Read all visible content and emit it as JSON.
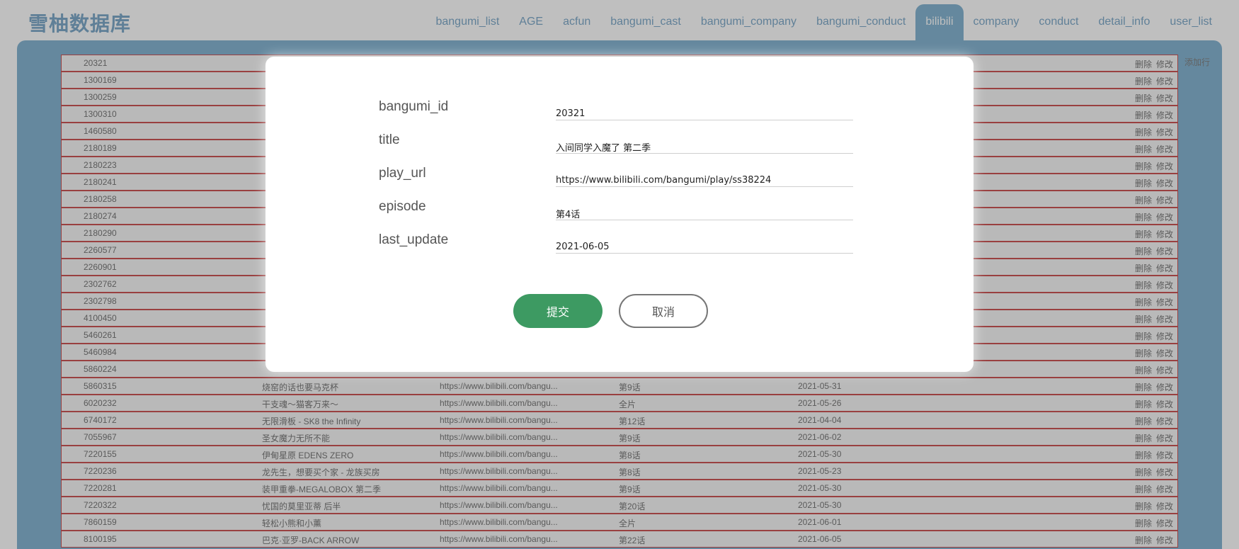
{
  "app": {
    "logo": "雪柚数据库"
  },
  "nav": {
    "tabs": [
      {
        "label": "bangumi_list",
        "active": false
      },
      {
        "label": "AGE",
        "active": false
      },
      {
        "label": "acfun",
        "active": false
      },
      {
        "label": "bangumi_cast",
        "active": false
      },
      {
        "label": "bangumi_company",
        "active": false
      },
      {
        "label": "bangumi_conduct",
        "active": false
      },
      {
        "label": "bilibili",
        "active": true
      },
      {
        "label": "company",
        "active": false
      },
      {
        "label": "conduct",
        "active": false
      },
      {
        "label": "detail_info",
        "active": false
      },
      {
        "label": "user_list",
        "active": false
      }
    ]
  },
  "table": {
    "add_row_label": "添加行",
    "delete_label": "删除",
    "edit_label": "修改",
    "rows": [
      {
        "id": "20321",
        "title": "",
        "url": "",
        "episode": "",
        "date": ""
      },
      {
        "id": "1300169",
        "title": "",
        "url": "",
        "episode": "",
        "date": ""
      },
      {
        "id": "1300259",
        "title": "",
        "url": "",
        "episode": "",
        "date": ""
      },
      {
        "id": "1300310",
        "title": "",
        "url": "",
        "episode": "",
        "date": ""
      },
      {
        "id": "1460580",
        "title": "",
        "url": "",
        "episode": "",
        "date": ""
      },
      {
        "id": "2180189",
        "title": "",
        "url": "",
        "episode": "",
        "date": ""
      },
      {
        "id": "2180223",
        "title": "",
        "url": "",
        "episode": "",
        "date": ""
      },
      {
        "id": "2180241",
        "title": "",
        "url": "",
        "episode": "",
        "date": ""
      },
      {
        "id": "2180258",
        "title": "",
        "url": "",
        "episode": "",
        "date": ""
      },
      {
        "id": "2180274",
        "title": "",
        "url": "",
        "episode": "",
        "date": ""
      },
      {
        "id": "2180290",
        "title": "",
        "url": "",
        "episode": "",
        "date": ""
      },
      {
        "id": "2260577",
        "title": "",
        "url": "",
        "episode": "",
        "date": ""
      },
      {
        "id": "2260901",
        "title": "",
        "url": "",
        "episode": "",
        "date": ""
      },
      {
        "id": "2302762",
        "title": "",
        "url": "",
        "episode": "",
        "date": ""
      },
      {
        "id": "2302798",
        "title": "",
        "url": "",
        "episode": "",
        "date": ""
      },
      {
        "id": "4100450",
        "title": "",
        "url": "",
        "episode": "",
        "date": ""
      },
      {
        "id": "5460261",
        "title": "",
        "url": "",
        "episode": "",
        "date": ""
      },
      {
        "id": "5460984",
        "title": "",
        "url": "",
        "episode": "",
        "date": ""
      },
      {
        "id": "5860224",
        "title": "",
        "url": "",
        "episode": "",
        "date": ""
      },
      {
        "id": "5860315",
        "title": "烧窑的话也要马克杯",
        "url": "https://www.bilibili.com/bangu...",
        "episode": "第9话",
        "date": "2021-05-31"
      },
      {
        "id": "6020232",
        "title": "干支魂～猫客万来～",
        "url": "https://www.bilibili.com/bangu...",
        "episode": "全片",
        "date": "2021-05-26"
      },
      {
        "id": "6740172",
        "title": "无限滑板 - SK8 the Infinity",
        "url": "https://www.bilibili.com/bangu...",
        "episode": "第12话",
        "date": "2021-04-04"
      },
      {
        "id": "7055967",
        "title": "圣女魔力无所不能",
        "url": "https://www.bilibili.com/bangu...",
        "episode": "第9话",
        "date": "2021-06-02"
      },
      {
        "id": "7220155",
        "title": "伊甸星原 EDENS ZERO",
        "url": "https://www.bilibili.com/bangu...",
        "episode": "第8话",
        "date": "2021-05-30"
      },
      {
        "id": "7220236",
        "title": "龙先生，想要买个家 - 龙族买房",
        "url": "https://www.bilibili.com/bangu...",
        "episode": "第8话",
        "date": "2021-05-23"
      },
      {
        "id": "7220281",
        "title": "装甲重拳-MEGALOBOX 第二季",
        "url": "https://www.bilibili.com/bangu...",
        "episode": "第9话",
        "date": "2021-05-30"
      },
      {
        "id": "7220322",
        "title": "忧国的莫里亚蒂 后半",
        "url": "https://www.bilibili.com/bangu...",
        "episode": "第20话",
        "date": "2021-05-30"
      },
      {
        "id": "7860159",
        "title": "轻松小熊和小薰",
        "url": "https://www.bilibili.com/bangu...",
        "episode": "全片",
        "date": "2021-06-01"
      },
      {
        "id": "8100195",
        "title": "巴克·亚罗-BACK ARROW",
        "url": "https://www.bilibili.com/bangu...",
        "episode": "第22话",
        "date": "2021-06-05"
      }
    ]
  },
  "modal": {
    "fields": [
      {
        "label": "bangumi_id",
        "value": "20321"
      },
      {
        "label": "title",
        "value": "入间同学入魔了 第二季"
      },
      {
        "label": "play_url",
        "value": "https://www.bilibili.com/bangumi/play/ss38224"
      },
      {
        "label": "episode",
        "value": "第4话"
      },
      {
        "label": "last_update",
        "value": "2021-06-05"
      }
    ],
    "submit_label": "提交",
    "cancel_label": "取消"
  }
}
